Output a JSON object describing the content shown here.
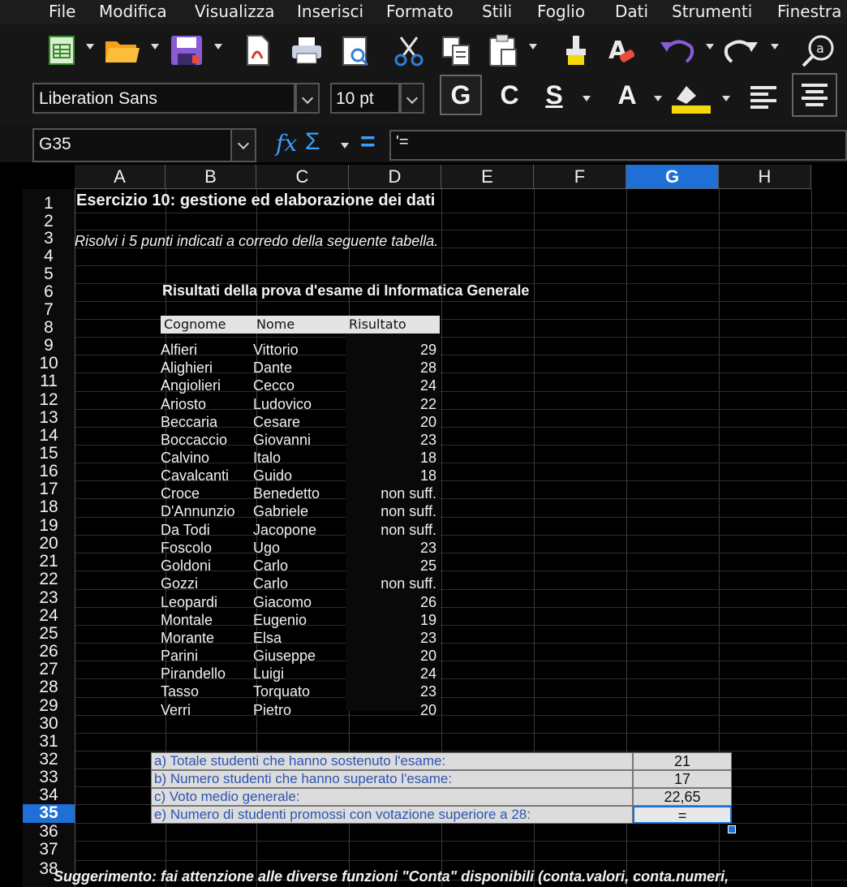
{
  "menu": [
    "File",
    "Modifica",
    "Visualizza",
    "Inserisci",
    "Formato",
    "Stili",
    "Foglio",
    "Dati",
    "Strumenti",
    "Finestra"
  ],
  "toolbar": {
    "icons": [
      "new-document-icon",
      "open-folder-icon",
      "save-icon",
      "export-pdf-icon",
      "print-icon",
      "print-preview-icon",
      "cut-icon",
      "copy-icon",
      "paste-icon",
      "clone-format-icon",
      "clear-format-icon",
      "undo-icon",
      "redo-icon",
      "find-replace-icon"
    ]
  },
  "format": {
    "font_name": "Liberation Sans",
    "font_size": "10 pt",
    "bold": "G",
    "italic": "C",
    "underline": "S",
    "font_color": "A",
    "highlight_color": "#f5d90a",
    "accent": "#1e6fd6"
  },
  "formula_bar": {
    "name_box": "G35",
    "sigma": "Σ",
    "equals": "=",
    "content": "'="
  },
  "columns": [
    "A",
    "B",
    "C",
    "D",
    "E",
    "F",
    "G",
    "H"
  ],
  "active_column": "G",
  "rows": [
    "1",
    "2",
    "3",
    "4",
    "5",
    "6",
    "7",
    "8",
    "9",
    "10",
    "11",
    "12",
    "13",
    "14",
    "15",
    "16",
    "17",
    "18",
    "19",
    "20",
    "21",
    "22",
    "23",
    "24",
    "25",
    "26",
    "27",
    "28",
    "29",
    "30",
    "31",
    "32",
    "33",
    "34",
    "35",
    "36",
    "37",
    "38"
  ],
  "active_row": "35",
  "sheet": {
    "title": "Esercizio 10: gestione ed elaborazione dei dati",
    "instruction": "Risolvi i 5 punti indicati a corredo della seguente tabella.",
    "table_title": "Risultati della prova d'esame di Informatica Generale",
    "headers": [
      "Cognome",
      "Nome",
      "Risultato"
    ],
    "records": [
      [
        "Alfieri",
        "Vittorio",
        "29"
      ],
      [
        "Alighieri",
        "Dante",
        "28"
      ],
      [
        "Angiolieri",
        "Cecco",
        "24"
      ],
      [
        "Ariosto",
        "Ludovico",
        "22"
      ],
      [
        "Beccaria",
        "Cesare",
        "20"
      ],
      [
        "Boccaccio",
        "Giovanni",
        "23"
      ],
      [
        "Calvino",
        "Italo",
        "18"
      ],
      [
        "Cavalcanti",
        "Guido",
        "18"
      ],
      [
        "Croce",
        "Benedetto",
        "non suff."
      ],
      [
        "D'Annunzio",
        "Gabriele",
        "non suff."
      ],
      [
        "Da Todi",
        "Jacopone",
        "non suff."
      ],
      [
        "Foscolo",
        "Ugo",
        "23"
      ],
      [
        "Goldoni",
        "Carlo",
        "25"
      ],
      [
        "Gozzi",
        "Carlo",
        "non suff."
      ],
      [
        "Leopardi",
        "Giacomo",
        "26"
      ],
      [
        "Montale",
        "Eugenio",
        "19"
      ],
      [
        "Morante",
        "Elsa",
        "23"
      ],
      [
        "Parini",
        "Giuseppe",
        "20"
      ],
      [
        "Pirandello",
        "Luigi",
        "24"
      ],
      [
        "Tasso",
        "Torquato",
        "23"
      ],
      [
        "Verri",
        "Pietro",
        "20"
      ]
    ],
    "questions": [
      {
        "label": "a) Totale studenti che hanno sostenuto l'esame:",
        "answer": "21"
      },
      {
        "label": "b) Numero studenti che hanno superato l'esame:",
        "answer": "17"
      },
      {
        "label": "c) Voto medio generale:",
        "answer": "22,65"
      },
      {
        "label": "e) Numero di studenti promossi con votazione superiore a 28:",
        "answer": "="
      }
    ],
    "hint": "Suggerimento: fai attenzione alle diverse funzioni \"Conta\" disponibili (conta.valori, conta.numeri,"
  }
}
